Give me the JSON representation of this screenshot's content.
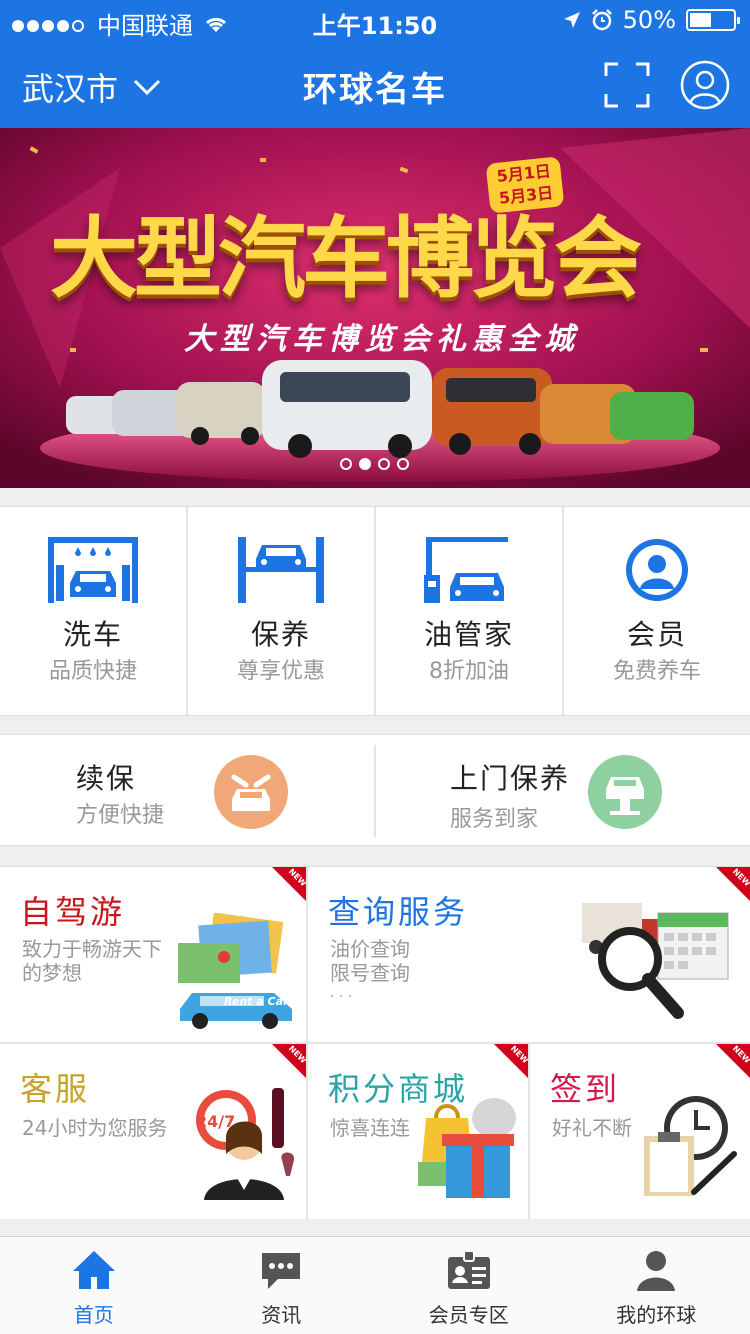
{
  "status": {
    "carrier": "中国联通",
    "time": "上午11:50",
    "battery": "50%",
    "battery_level": 0.5
  },
  "nav": {
    "city": "武汉市",
    "title": "环球名车",
    "scan_icon": "scan-icon",
    "user_icon": "user-icon"
  },
  "banner": {
    "headline": "大型汽车博览会",
    "subline": "大型汽车博览会礼惠全城",
    "date_start": "5月1日",
    "date_end": "5月3日",
    "page_count": 4,
    "current_page": 2
  },
  "services": [
    {
      "name": "洗车",
      "desc": "品质快捷",
      "icon": "car-wash-icon"
    },
    {
      "name": "保养",
      "desc": "尊享优惠",
      "icon": "car-lift-icon"
    },
    {
      "name": "油管家",
      "desc": "8折加油",
      "icon": "fuel-pump-icon"
    },
    {
      "name": "会员",
      "desc": "免费养车",
      "icon": "member-icon"
    }
  ],
  "insurance": {
    "left": {
      "title": "续保",
      "desc": "方便快捷",
      "color": "#f0a878"
    },
    "right": {
      "title": "上门保养",
      "desc": "服务到家",
      "color": "#8fd0a0"
    }
  },
  "features": {
    "self_drive": {
      "title": "自驾游",
      "desc1": "致力于畅游天下",
      "desc2": "的梦想",
      "color": "#c8161d",
      "car_text": "Rent a Car"
    },
    "query": {
      "title": "查询服务",
      "desc1": "油价查询",
      "desc2": "限号查询",
      "desc3": "· · ·",
      "color": "#1d74e3"
    },
    "support": {
      "title": "客服",
      "desc1": "24小时为您服务",
      "color": "#c9a227",
      "badge": "24/7"
    },
    "points": {
      "title": "积分商城",
      "desc1": "惊喜连连",
      "color": "#2aa3a6"
    },
    "checkin": {
      "title": "签到",
      "desc1": "好礼不断",
      "color": "#d6174a"
    },
    "new_label": "NEW"
  },
  "tabs": [
    {
      "label": "首页",
      "icon": "home-icon",
      "active": true
    },
    {
      "label": "资讯",
      "icon": "chat-icon",
      "active": false
    },
    {
      "label": "会员专区",
      "icon": "id-card-icon",
      "active": false
    },
    {
      "label": "我的环球",
      "icon": "person-icon",
      "active": false
    }
  ]
}
